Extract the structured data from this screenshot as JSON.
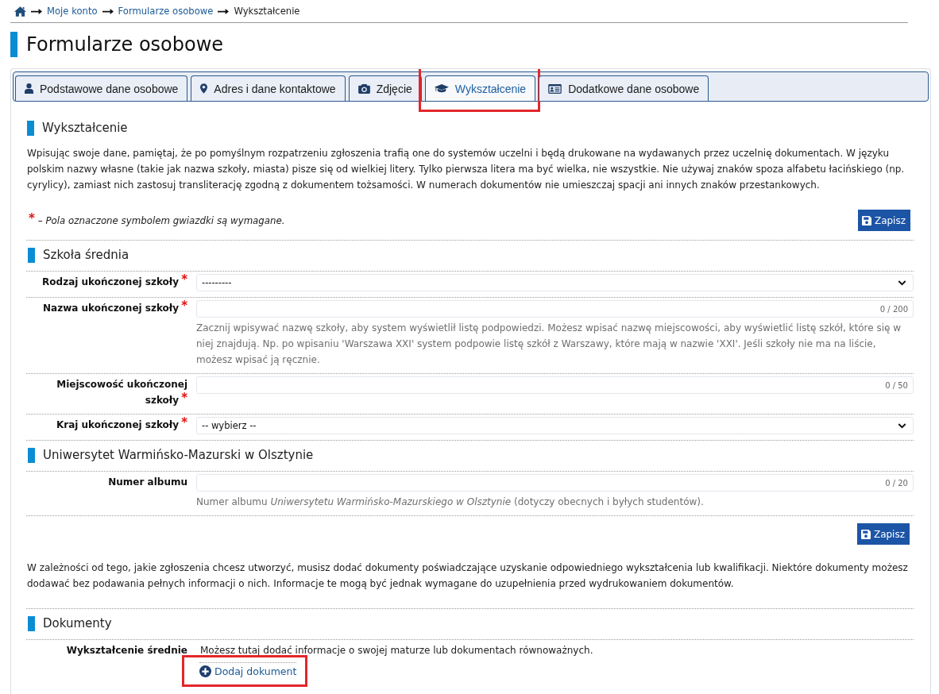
{
  "breadcrumb": [
    {
      "label": "Moje konto",
      "current": false
    },
    {
      "label": "Formularze osobowe",
      "current": false
    },
    {
      "label": "Wykształcenie",
      "current": true
    }
  ],
  "page_title": "Formularze osobowe",
  "tabs": [
    {
      "label": "Podstawowe dane osobowe",
      "selected": false,
      "highlighted": false
    },
    {
      "label": "Adres i dane kontaktowe",
      "selected": false,
      "highlighted": false
    },
    {
      "label": "Zdjęcie",
      "selected": false,
      "highlighted": false
    },
    {
      "label": "Wykształcenie",
      "selected": true,
      "highlighted": true
    },
    {
      "label": "Dodatkowe dane osobowe",
      "selected": false,
      "highlighted": false
    }
  ],
  "section": {
    "title": "Wykształcenie",
    "intro": "Wpisując swoje dane, pamiętaj, że po pomyślnym rozpatrzeniu zgłoszenia trafią one do systemów uczelni i będą drukowane na wydawanych przez uczelnię dokumentach. W języku polskim nazwy własne (takie jak nazwa szkoły, miasta) pisze się od wielkiej litery. Tylko pierwsza litera ma być wielka, nie wszystkie. Nie używaj znaków spoza alfabetu łacińskiego (np. cyrylicy), zamiast nich zastosuj transliterację zgodną z dokumentem tożsamości. W numerach dokumentów nie umieszczaj spacji ani innych znaków przestankowych.",
    "required_note": {
      "marker": "*",
      "text": "– Pola oznaczone symbolem gwiazdki są wymagane."
    },
    "save_button": "Zapisz"
  },
  "groups": [
    {
      "title": "Szkoła średnia",
      "fields": [
        {
          "kind": "select",
          "label": "Rodzaj ukończonej szkoły",
          "marker": "*",
          "value": "---------"
        },
        {
          "kind": "text",
          "label": "Nazwa ukończonej szkoły",
          "marker": "*",
          "counter": "0 / 200",
          "help": "Zacznij wpisywać nazwę szkoły, aby system wyświetlił listę podpowiedzi. Możesz wpisać nazwę miejscowości, aby wyświetlić listę szkół, które się w niej znajdują. Np. po wpisaniu 'Warszawa XXI' system podpowie listę szkół z Warszawy, które mają w nazwie 'XXI'. Jeśli szkoły nie ma na liście, możesz wpisać ją ręcznie."
        },
        {
          "kind": "text",
          "label": "Miejscowość ukończonej szkoły",
          "marker": "*",
          "counter": "0 / 50"
        },
        {
          "kind": "select",
          "label": "Kraj ukończonej szkoły",
          "marker": "*",
          "value": "-- wybierz --"
        }
      ]
    },
    {
      "title": "Uniwersytet Warmińsko-Mazurski w Olsztynie",
      "fields": [
        {
          "kind": "text",
          "label": "Numer albumu",
          "counter": "0 / 20",
          "help": "Numer albumu *Uniwersytetu Warmińsko-Mazurskiego w Olsztynie* (dotyczy obecnych i byłych studentów)."
        }
      ]
    }
  ],
  "save_button": "Zapisz",
  "documents_info": "W zależności od tego, jakie zgłoszenia chcesz utworzyć, musisz dodać dokumenty poświadczające uzyskanie odpowiedniego wykształcenia lub kwalifikacji. Niektóre dokumenty możesz dodawać bez podawania pełnych informacji o nich. Informacje te mogą być jednak wymagane do uzupełnienia przed wydrukowaniem dokumentów.",
  "documents": {
    "title": "Dokumenty",
    "rows": [
      {
        "label": "Wykształcenie średnie",
        "description": "Możesz tutaj dodać informacje o swojej maturze lub dokumentach równoważnych.",
        "add_button": {
          "label": "Dodaj dokument",
          "highlighted": true
        }
      }
    ]
  }
}
